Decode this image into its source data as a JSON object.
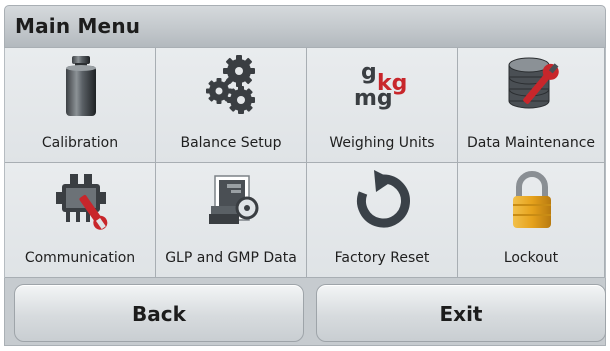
{
  "header": {
    "title": "Main Menu"
  },
  "menu": {
    "items": [
      {
        "label": "Calibration",
        "icon": "calibration-weight-icon"
      },
      {
        "label": "Balance Setup",
        "icon": "balance-setup-gears-icon"
      },
      {
        "label": "Weighing Units",
        "icon": "weighing-units-icon",
        "icon_text": {
          "g": "g",
          "kg": "kg",
          "mg": "mg"
        }
      },
      {
        "label": "Data Maintenance",
        "icon": "data-maintenance-icon"
      },
      {
        "label": "Communication",
        "icon": "communication-icon"
      },
      {
        "label": "GLP and GMP Data",
        "icon": "glp-gmp-data-icon"
      },
      {
        "label": "Factory Reset",
        "icon": "factory-reset-icon"
      },
      {
        "label": "Lockout",
        "icon": "lockout-padlock-icon"
      }
    ]
  },
  "footer": {
    "back_label": "Back",
    "exit_label": "Exit"
  },
  "colors": {
    "accent_red": "#c8262b",
    "lock_gold": "#e6a21c",
    "reset_arrow": "#3a4148"
  }
}
